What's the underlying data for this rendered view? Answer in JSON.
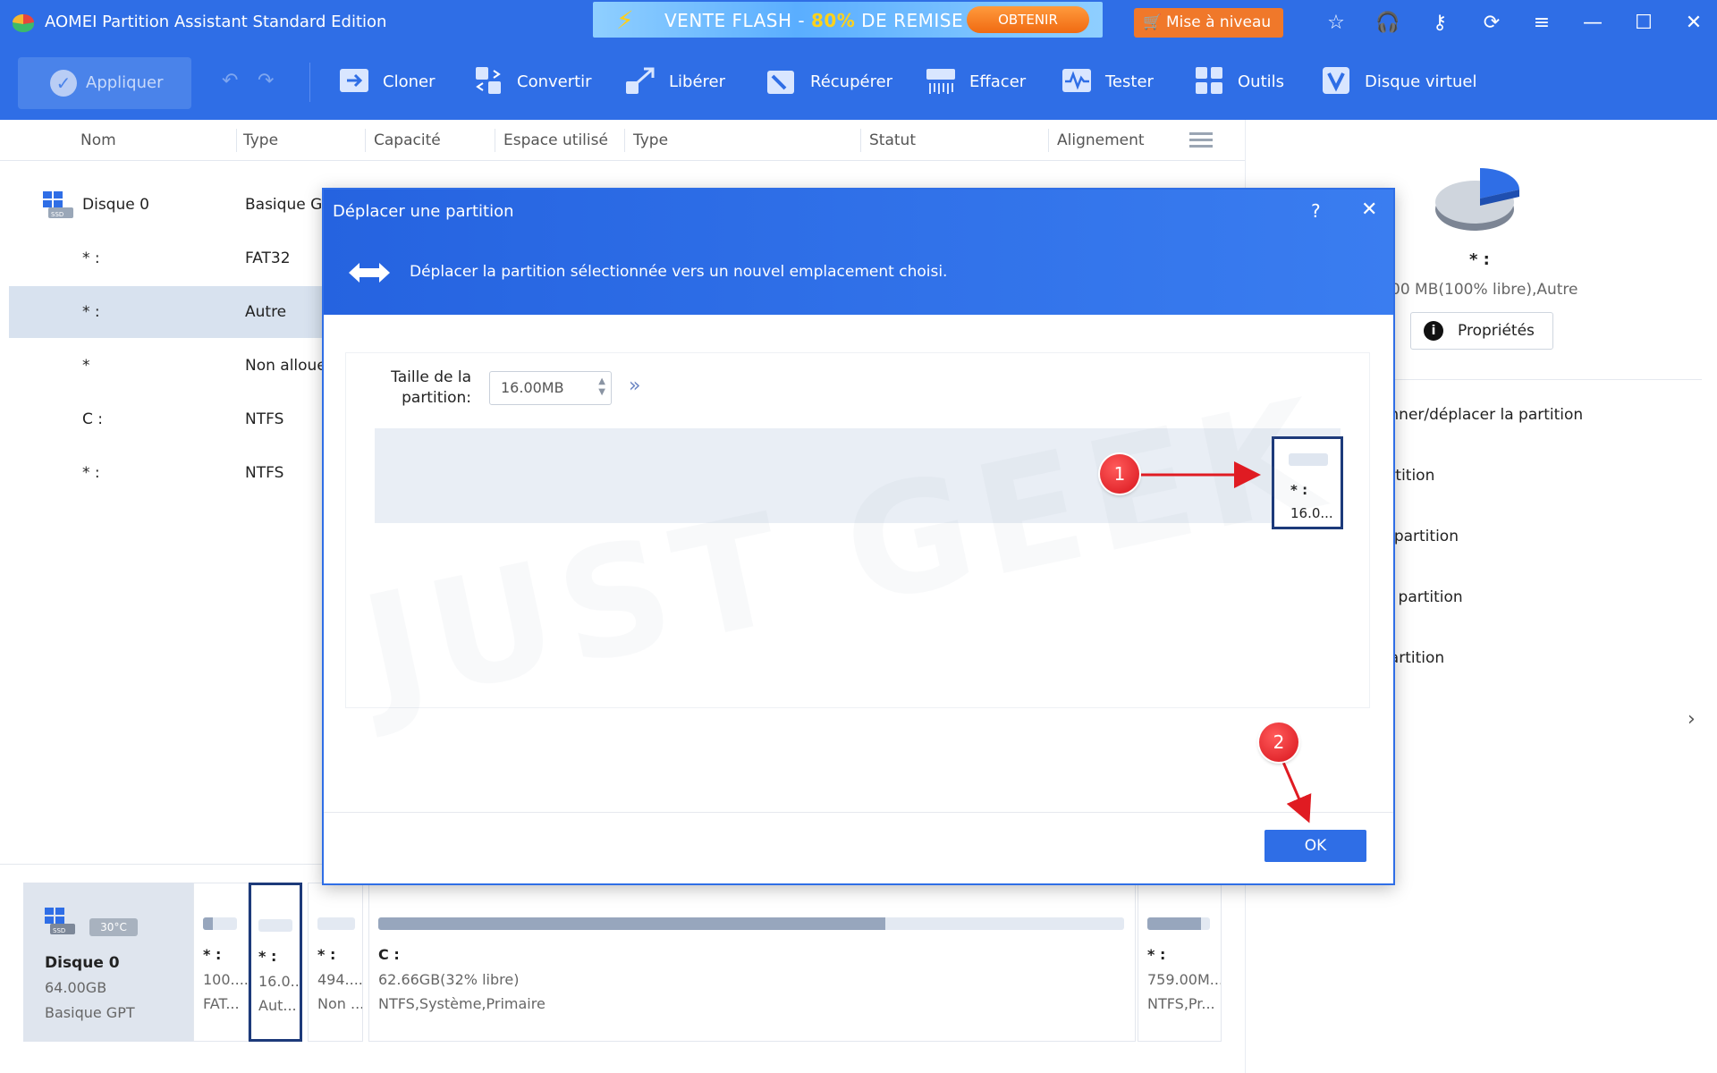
{
  "window": {
    "title": "AOMEI Partition Assistant Standard Edition",
    "promo": {
      "text_start": "VENTE FLASH - ",
      "percent": "80%",
      "text_end": " DE REMISE",
      "button": "OBTENIR"
    },
    "upgrade_label": "Mise à niveau"
  },
  "toolbar": {
    "apply_label": "Appliquer",
    "tools": [
      "Cloner",
      "Convertir",
      "Libérer",
      "Récupérer",
      "Effacer",
      "Tester",
      "Outils",
      "Disque virtuel"
    ]
  },
  "table": {
    "headers": [
      "Nom",
      "Type",
      "Capacité",
      "Espace utilisé",
      "Type",
      "Statut",
      "Alignement"
    ],
    "rows": [
      {
        "name": "Disque 0",
        "type": "Basique G"
      },
      {
        "name": "* :",
        "type": "FAT32"
      },
      {
        "name": "* :",
        "type": "Autre"
      },
      {
        "name": "*",
        "type": "Non alloue"
      },
      {
        "name": "C :",
        "type": "NTFS"
      },
      {
        "name": "* :",
        "type": "NTFS"
      }
    ]
  },
  "right_panel": {
    "partition_name": "* :",
    "partition_info": "00 MB(100% libre),Autre",
    "properties_label": "Propriétés",
    "operations": [
      "onner/déplacer la partition",
      "artition",
      "a partition",
      "la partition",
      "partition"
    ]
  },
  "disk_map": {
    "disk": {
      "name": "Disque 0",
      "size": "64.00GB",
      "type": "Basique GPT",
      "temperature": "30°C",
      "ssd_label": "SSD"
    },
    "segments": [
      {
        "name": "* :",
        "line1": "100....",
        "line2": "FAT...",
        "fill": 0.3
      },
      {
        "name": "* :",
        "line1": "16.0...",
        "line2": "Aut...",
        "fill": 0.0
      },
      {
        "name": "* :",
        "line1": "494....",
        "line2": "Non ...",
        "fill": 0.0
      },
      {
        "name": "C :",
        "line1": "62.66GB(32% libre)",
        "line2": "NTFS,Système,Primaire",
        "fill": 0.68
      },
      {
        "name": "* :",
        "line1": "759.00M...",
        "line2": "NTFS,Pr...",
        "fill": 0.85
      }
    ]
  },
  "modal": {
    "title": "Déplacer une partition",
    "help": "?",
    "description": "Déplacer la partition sélectionnée vers un nouvel emplacement choisi.",
    "size_label": "Taille de la partition:",
    "size_value": "16.00MB",
    "partition": {
      "name": "* :",
      "size": "16.0..."
    },
    "ok_label": "OK"
  },
  "annotations": {
    "badge1": "1",
    "badge2": "2"
  },
  "watermark": "JUST GEEK",
  "colors": {
    "brand_blue": "#2f6ee6",
    "selection_border": "#1d3a7a",
    "badge_red": "#d8141c"
  }
}
